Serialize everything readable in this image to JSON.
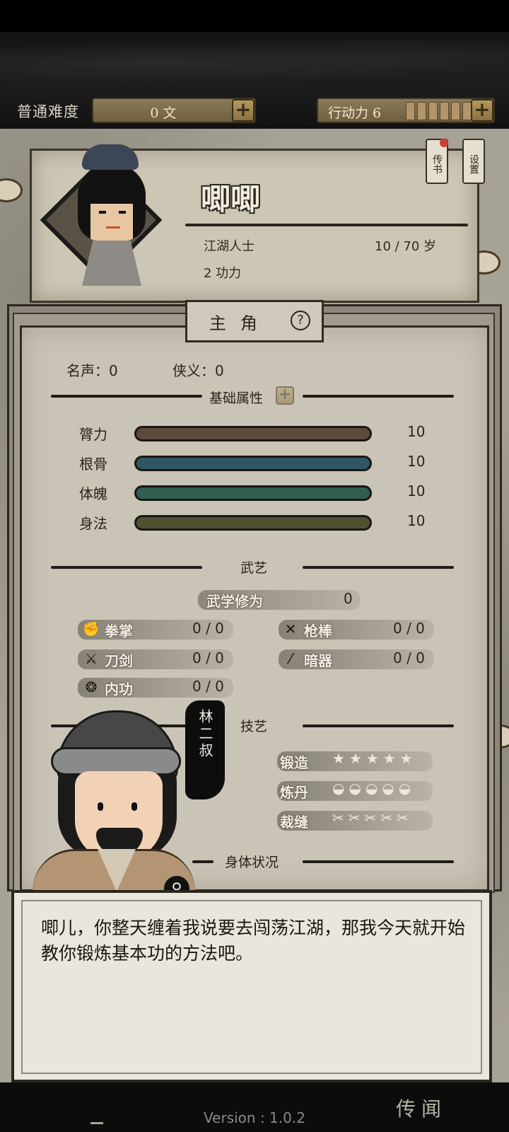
{
  "topbar": {
    "difficulty": "普通难度",
    "money": "0 文",
    "action_points_label": "行动力 6",
    "action_segments": 6
  },
  "hero": {
    "name": "唧唧",
    "title": "江湖人士",
    "age": "10 / 70 岁",
    "power": "2 功力"
  },
  "tags": {
    "letters": "传书",
    "settings": "设置"
  },
  "section": {
    "label": "主角",
    "help": "?"
  },
  "reputation": {
    "fame": "名声：0",
    "chivalry": "侠义：0"
  },
  "basic_attributes": {
    "title": "基础属性",
    "items": [
      {
        "name": "膂力",
        "value": "10",
        "color": "#5e4a3b"
      },
      {
        "name": "根骨",
        "value": "10",
        "color": "#2f5763"
      },
      {
        "name": "体魄",
        "value": "10",
        "color": "#2f5e52"
      },
      {
        "name": "身法",
        "value": "10",
        "color": "#4f5131"
      }
    ]
  },
  "martial": {
    "title": "武艺",
    "cultivation_label": "武学修为",
    "cultivation_value": "0",
    "skills": [
      {
        "icon": "fist-icon",
        "name": "拳掌",
        "value": "0 / 0"
      },
      {
        "icon": "spear-icon",
        "name": "枪棒",
        "value": "0 / 0"
      },
      {
        "icon": "sword-icon",
        "name": "刀剑",
        "value": "0 / 0"
      },
      {
        "icon": "dart-icon",
        "name": "暗器",
        "value": "0 / 0"
      },
      {
        "icon": "inner-power-icon",
        "name": "内功",
        "value": "0 / 0"
      }
    ]
  },
  "crafts": {
    "title": "技艺",
    "items": [
      {
        "name": "锻造",
        "level": 0
      },
      {
        "name": "炼丹",
        "level": 0
      },
      {
        "name": "裁缝",
        "level": 0
      }
    ]
  },
  "body_status": {
    "title": "身体状况"
  },
  "dialog": {
    "speaker": "林二叔",
    "text": "唧儿，你整天缠着我说要去闯荡江湖，那我今天就开始教你锻炼基本功的方法吧。"
  },
  "footer": {
    "version": "Version : 1.0.2",
    "corner_label": "传闻"
  }
}
